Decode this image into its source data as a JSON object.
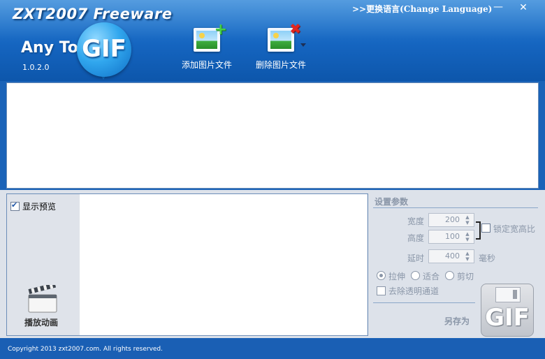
{
  "header": {
    "app_title": "ZXT2007 Freeware",
    "logo_prefix": "Any To",
    "logo_gif": "GIF",
    "version": "1.0.2.0",
    "language_link": ">>更换语言(Change Language)"
  },
  "toolbar": {
    "add_label": "添加图片文件",
    "delete_label": "删除图片文件"
  },
  "preview": {
    "show_preview_label": "显示预览",
    "show_preview_checked": true,
    "play_label": "播放动画"
  },
  "settings": {
    "title": "设置参数",
    "width_label": "宽度",
    "width_value": "200",
    "height_label": "高度",
    "height_value": "100",
    "lock_ratio_label": "锁定宽高比",
    "delay_label": "延时",
    "delay_value": "400",
    "delay_unit": "毫秒",
    "radio_stretch": "拉伸",
    "radio_fit": "适合",
    "radio_crop": "剪切",
    "selected_mode": "拉伸",
    "remove_alpha_label": "去除透明通道",
    "save_as_label": "另存为",
    "save_icon_text": "GIF"
  },
  "footer": {
    "copyright": "Copyright 2013 zxt2007.com. All rights reserved."
  },
  "colors": {
    "header_blue": "#1565c0",
    "footer_blue": "#1a5fb4",
    "disabled_text": "#8a96a8"
  }
}
